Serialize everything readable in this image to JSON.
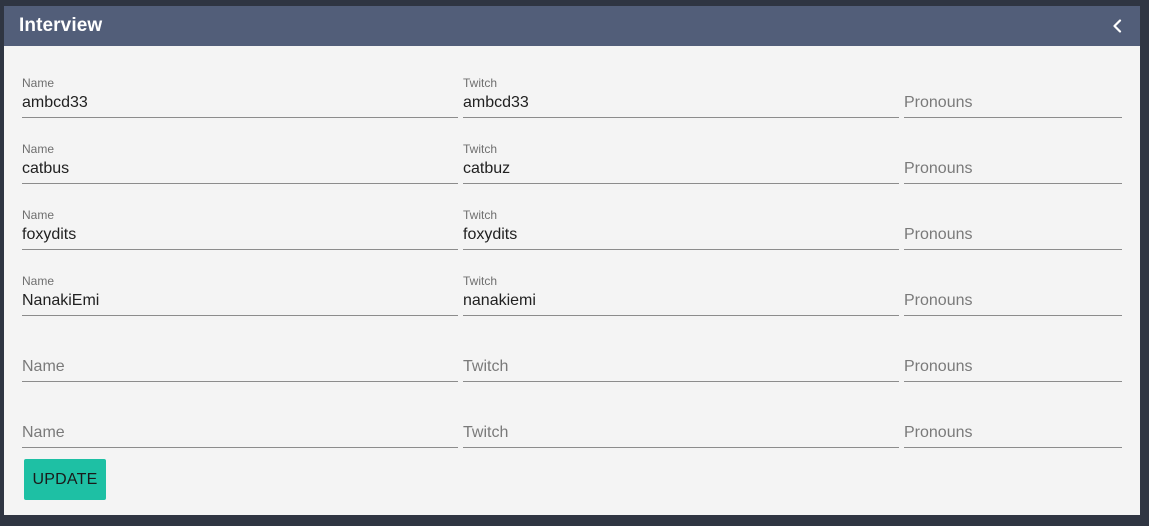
{
  "panel": {
    "title": "Interview",
    "collapse_icon": "chevron-left-icon"
  },
  "labels": {
    "name": "Name",
    "twitch": "Twitch",
    "pronouns": "Pronouns"
  },
  "rows": [
    {
      "name": "ambcd33",
      "twitch": "ambcd33",
      "pronouns": ""
    },
    {
      "name": "catbus",
      "twitch": "catbuz",
      "pronouns": ""
    },
    {
      "name": "foxydits",
      "twitch": "foxydits",
      "pronouns": ""
    },
    {
      "name": "NanakiEmi",
      "twitch": "nanakiemi",
      "pronouns": ""
    },
    {
      "name": "",
      "twitch": "",
      "pronouns": ""
    },
    {
      "name": "",
      "twitch": "",
      "pronouns": ""
    }
  ],
  "update_button": {
    "label": "UPDATE"
  },
  "colors": {
    "header": "#525e79",
    "panel_bg": "#f4f4f4",
    "page_bg": "#2f3542",
    "button": "#1ec0a4"
  }
}
